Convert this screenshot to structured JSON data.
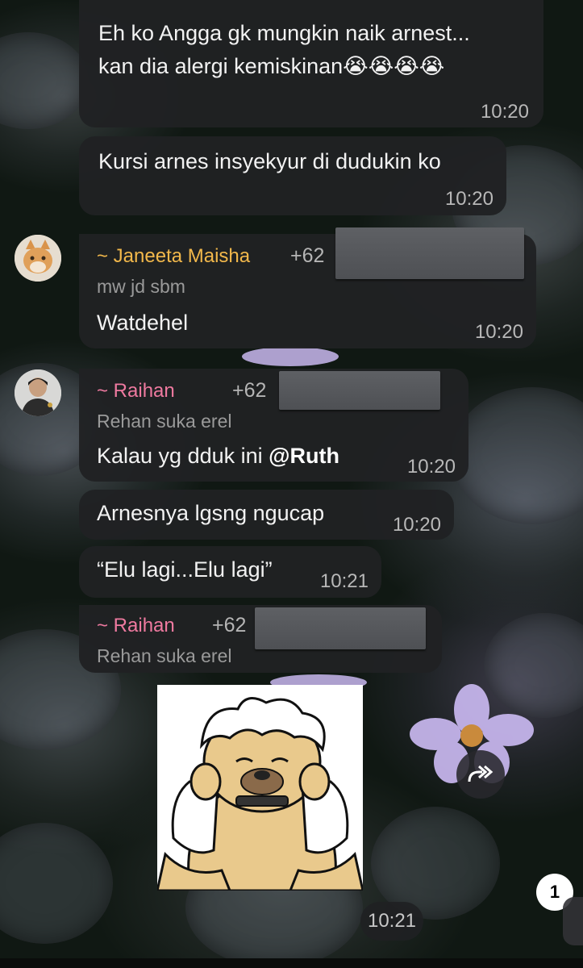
{
  "messages": [
    {
      "id": 1,
      "type": "outgoing-ish",
      "lines": [
        "Eh ko Angga gk mungkin naik arnest...",
        "kan dia alergi kemiskinan😭😭😭😭"
      ],
      "time": "10:20"
    },
    {
      "id": 2,
      "text": "Kursi arnes insyekyur di dudukin ko",
      "time": "10:20"
    },
    {
      "id": 3,
      "sender": "~ Janeeta Maisha",
      "phone": "+62",
      "subtitle": "mw jd sbm",
      "text": "Watdehel",
      "time": "10:20"
    },
    {
      "id": 4,
      "sender": "~ Raihan",
      "phone": "+62",
      "subtitle": "Rehan suka erel",
      "text_before": "Kalau yg dduk ini ",
      "mention": "@Ruth",
      "time": "10:20"
    },
    {
      "id": 5,
      "text": "Arnesnya lgsng ngucap",
      "time": "10:20"
    },
    {
      "id": 6,
      "text": "“Elu lagi...Elu lagi”",
      "time": "10:21"
    },
    {
      "id": 7,
      "sender": "~ Raihan",
      "phone": "+62",
      "subtitle": "Rehan suka erel",
      "sticker": "crying-dog-sticker",
      "time": "10:21"
    }
  ],
  "unread_badge": "1",
  "icons": {
    "forward": "forward-icon",
    "avatar_janeeta": "cat-avatar",
    "avatar_raihan": "person-avatar"
  },
  "colors": {
    "sender_janeeta": "#f2b84b",
    "sender_raihan": "#ef7aa0",
    "bubble": "#202123"
  }
}
